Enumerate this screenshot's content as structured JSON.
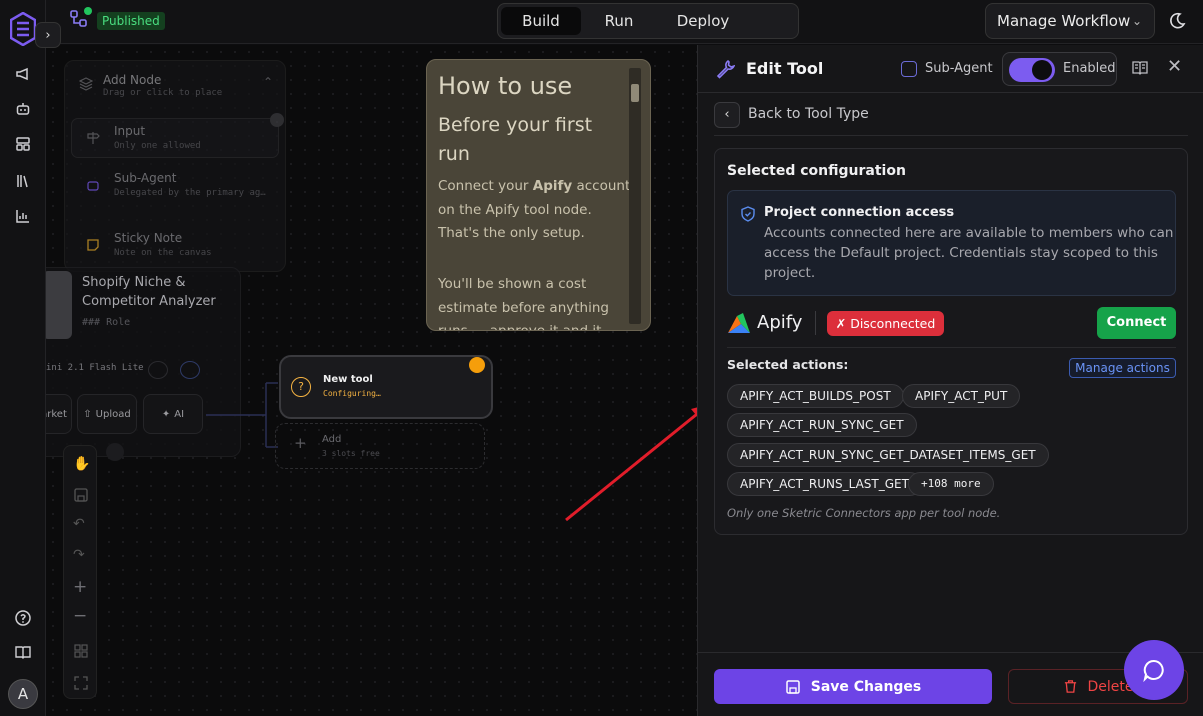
{
  "topbar": {
    "status_badge": "Published",
    "tabs": [
      {
        "label": "Build"
      },
      {
        "label": "Run"
      },
      {
        "label": "Deploy"
      }
    ],
    "manage_label": "Manage Workflow"
  },
  "canvas": {
    "add_node": {
      "title": "Add Node",
      "subtitle": "Drag or click to place",
      "items": [
        {
          "label": "Input",
          "desc": "Only one allowed"
        },
        {
          "label": "Sub-Agent",
          "desc": "Delegated by the primary ag…"
        },
        {
          "label": "Sticky Note",
          "desc": "Note on the canvas"
        }
      ]
    },
    "agent": {
      "title": "Shopify Niche & Competitor Analyzer",
      "role": "### Role",
      "model": "ini 2.1 Flash Lite",
      "buttons": [
        "arket",
        "Upload",
        "AI"
      ]
    },
    "tool_node": {
      "title": "New tool",
      "status": "Configuring…"
    },
    "add_slot": {
      "title": "Add",
      "subtitle": "3 slots free"
    },
    "howto": {
      "title": "How to use",
      "heading": "Before your first run",
      "p1_prefix": "Connect your ",
      "p1_bold": "Apify",
      "p1_suffix": " account on the Apify tool node. That's the only setup.",
      "p2": "You'll be shown a cost estimate before anything runs — approve it and it"
    }
  },
  "panel": {
    "title": "Edit Tool",
    "sub_agent_label": "Sub-Agent",
    "enabled_label": "Enabled",
    "back_label": "Back to Tool Type",
    "config_title": "Selected configuration",
    "access_title": "Project connection access",
    "access_body": "Accounts connected here are available to members who can access the Default project. Credentials stay scoped to this project.",
    "app_name": "Apify",
    "status": "Disconnected",
    "connect_label": "Connect",
    "actions_label": "Selected actions:",
    "manage_actions_label": "Manage actions",
    "actions": [
      "APIFY_ACT_BUILDS_POST",
      "APIFY_ACT_PUT",
      "APIFY_ACT_RUN_SYNC_GET",
      "APIFY_ACT_RUN_SYNC_GET_DATASET_ITEMS_GET",
      "APIFY_ACT_RUNS_LAST_GET"
    ],
    "more_label": "+108 more",
    "note": "Only one Sketric Connectors app per tool node.",
    "save_label": "Save Changes",
    "delete_label": "Delete"
  },
  "user": {
    "avatar_initial": "A"
  },
  "colors": {
    "accent": "#6d44e6",
    "danger": "#dc2f3b",
    "success": "#16a34a",
    "warning": "#f59e0b"
  }
}
